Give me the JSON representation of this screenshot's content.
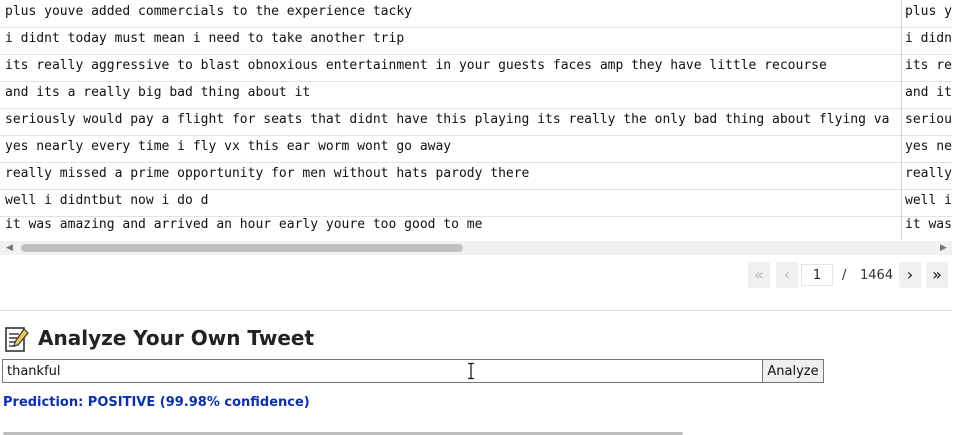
{
  "table": {
    "rows": [
      {
        "text": "plus youve added commercials to the experience tacky",
        "text2": "plus y"
      },
      {
        "text": "i didnt today must mean i need to take another trip",
        "text2": "i didn"
      },
      {
        "text": "its really aggressive to blast obnoxious entertainment in your guests faces amp they have little recourse",
        "text2": "its re"
      },
      {
        "text": "and its a really big bad thing about it",
        "text2": "and it"
      },
      {
        "text": "seriously would pay a flight for seats that didnt have this playing its really the only bad thing about flying va",
        "text2": "seriou"
      },
      {
        "text": "yes nearly every time i fly vx this ear worm wont go away",
        "text2": "yes ne"
      },
      {
        "text": "really missed a prime opportunity for men without hats parody there",
        "text2": "really"
      },
      {
        "text": "well i didntbut now i do d",
        "text2": "well i"
      },
      {
        "text": "it was amazing and arrived an hour early youre too good to me",
        "text2": "it was"
      }
    ]
  },
  "pagination": {
    "first_icon": "«",
    "prev_icon": "‹",
    "current_page": "1",
    "separator": "/",
    "total_pages": "1464",
    "next_icon": "›",
    "last_icon": "»"
  },
  "analyze": {
    "icon": "memo-icon",
    "title": "Analyze Your Own Tweet",
    "input_value": "thankful",
    "button_label": "Analyze",
    "prediction": "Prediction: POSITIVE (99.98% confidence)"
  },
  "colors": {
    "prediction": "#0a2fb5",
    "row_border": "#e2e2e2"
  }
}
